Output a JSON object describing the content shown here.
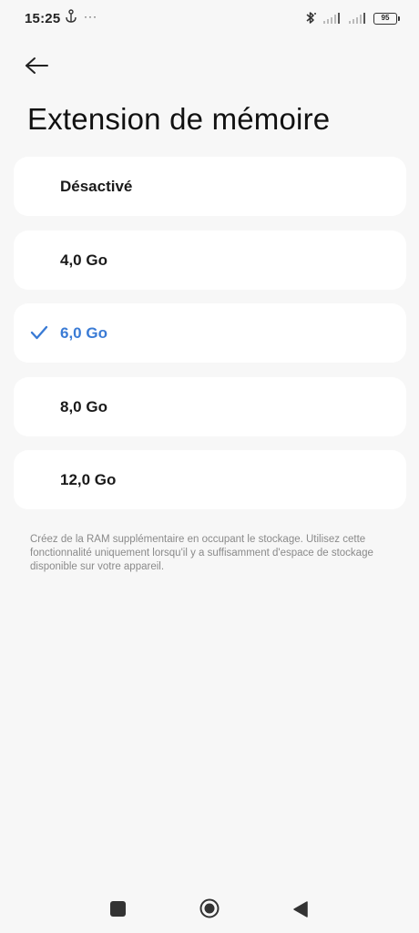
{
  "status_bar": {
    "time": "15:25",
    "more": "···",
    "battery": "95"
  },
  "header": {
    "title": "Extension de mémoire"
  },
  "options": [
    {
      "label": "Désactivé",
      "selected": false
    },
    {
      "label": "4,0 Go",
      "selected": false
    },
    {
      "label": "6,0 Go",
      "selected": true
    },
    {
      "label": "8,0 Go",
      "selected": false
    },
    {
      "label": "12,0 Go",
      "selected": false
    }
  ],
  "description": "Créez de la RAM supplémentaire en occupant le stockage. Utilisez cette fonctionnalité uniquement lorsqu'il y a suffisamment d'espace de stockage disponible sur votre appareil.",
  "colors": {
    "accent": "#3a7bd5",
    "background": "#f7f7f7",
    "card": "#ffffff"
  },
  "icons": {
    "back": "arrow-left-icon",
    "check": "checkmark-icon",
    "bluetooth": "bluetooth-icon",
    "signal": "signal-icon",
    "battery": "battery-icon",
    "nav_recent": "square-icon",
    "nav_home": "circle-icon",
    "nav_back": "triangle-icon"
  }
}
